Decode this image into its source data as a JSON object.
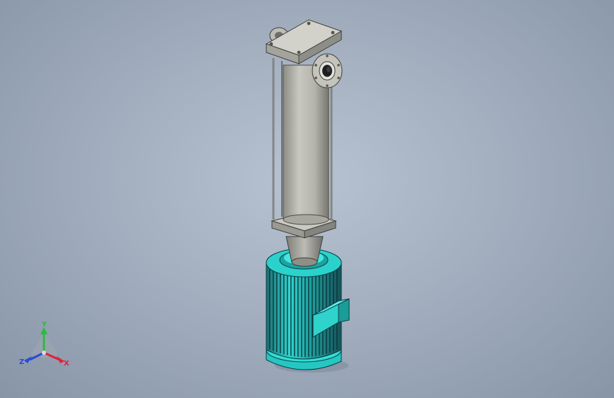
{
  "colors": {
    "background_center": "#b7c3d2",
    "background_edge": "#8895a7",
    "metal_gray": "#b9b9b0",
    "metal_dark": "#6f6f68",
    "motor_cyan": "#2fd6cf",
    "motor_dark": "#1a4f57",
    "axis_x": "#e0203a",
    "axis_y": "#2bbd3a",
    "axis_z": "#2a49d8"
  },
  "model": {
    "name": "pump-motor-assembly",
    "parts": [
      "top-plate",
      "outlet-flange",
      "rear-flange",
      "column-tube",
      "tie-rod",
      "bottom-plate",
      "adapter-cone",
      "motor-body",
      "terminal-box",
      "motor-base"
    ]
  },
  "triad": {
    "x_label": "X",
    "y_label": "Y",
    "z_label": "Z"
  }
}
